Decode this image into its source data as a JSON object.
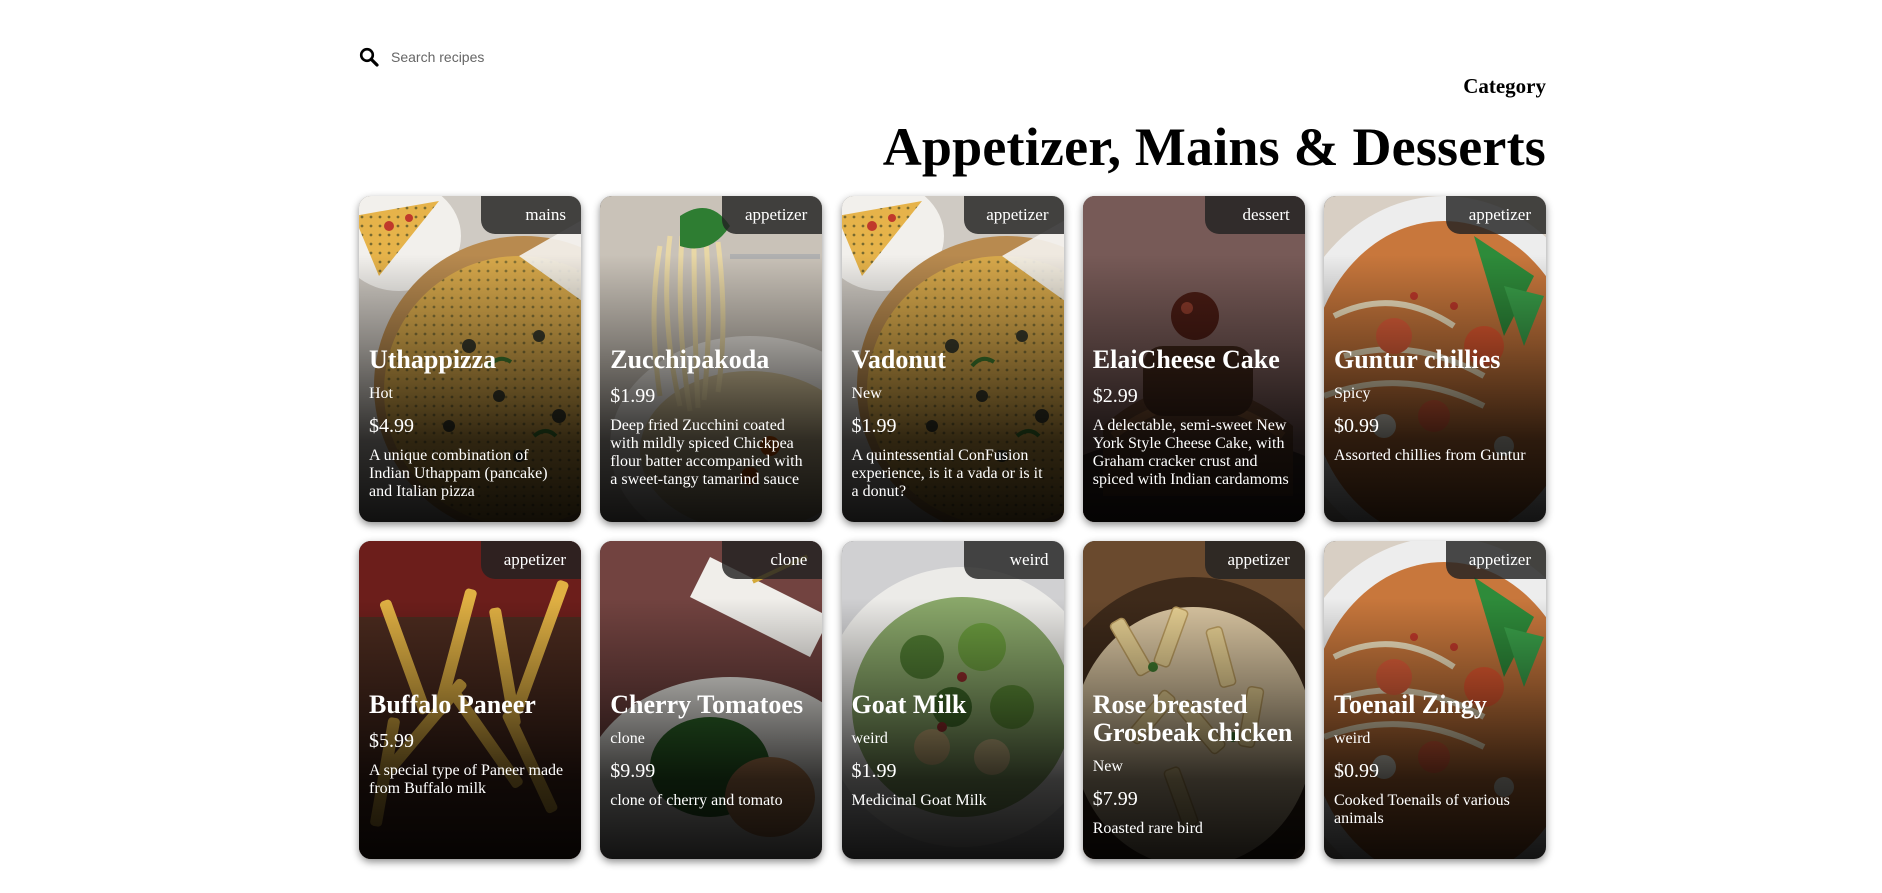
{
  "search": {
    "placeholder": "Search recipes"
  },
  "category_heading": "Category",
  "page_title": "Appetizer, Mains & Desserts",
  "dishes": [
    {
      "name": "Uthappizza",
      "category": "mains",
      "label": "Hot",
      "price": "$4.99",
      "description": "A unique combination of Indian Uthappam (pancake) and Italian pizza",
      "image": "pizza-image"
    },
    {
      "name": "Zucchipakoda",
      "category": "appetizer",
      "label": "",
      "price": "$1.99",
      "description": "Deep fried Zucchini coated with mildly spiced Chickpea flour batter accompanied with a sweet-tangy tamarind sauce",
      "image": "pasta-image"
    },
    {
      "name": "Vadonut",
      "category": "appetizer",
      "label": "New",
      "price": "$1.99",
      "description": "A quintessential ConFusion experience, is it a vada or is it a donut?",
      "image": "pizza-image"
    },
    {
      "name": "ElaiCheese Cake",
      "category": "dessert",
      "label": "",
      "price": "$2.99",
      "description": "A delectable, semi-sweet New York Style Cheese Cake, with Graham cracker crust and spiced with Indian cardamoms",
      "image": "dessert-image"
    },
    {
      "name": "Guntur chillies",
      "category": "appetizer",
      "label": "Spicy",
      "price": "$0.99",
      "description": "Assorted chillies from Guntur",
      "image": "noodle-soup-image"
    },
    {
      "name": "Buffalo Paneer",
      "category": "appetizer",
      "label": "",
      "price": "$5.99",
      "description": "A special type of Paneer made from Buffalo milk",
      "image": "fries-image"
    },
    {
      "name": "Cherry Tomatoes",
      "category": "clone",
      "label": "clone",
      "price": "$9.99",
      "description": "clone of cherry and tomato",
      "image": "plated-dish-image"
    },
    {
      "name": "Goat Milk",
      "category": "weird",
      "label": "weird",
      "price": "$1.99",
      "description": "Medicinal Goat Milk",
      "image": "salad-image"
    },
    {
      "name": "Rose breasted Grosbeak chicken",
      "category": "appetizer",
      "label": "New",
      "price": "$7.99",
      "description": "Roasted rare bird",
      "image": "penne-image"
    },
    {
      "name": "Toenail Zingy",
      "category": "appetizer",
      "label": "weird",
      "price": "$0.99",
      "description": "Cooked Toenails of various animals",
      "image": "noodle-soup-image"
    }
  ]
}
